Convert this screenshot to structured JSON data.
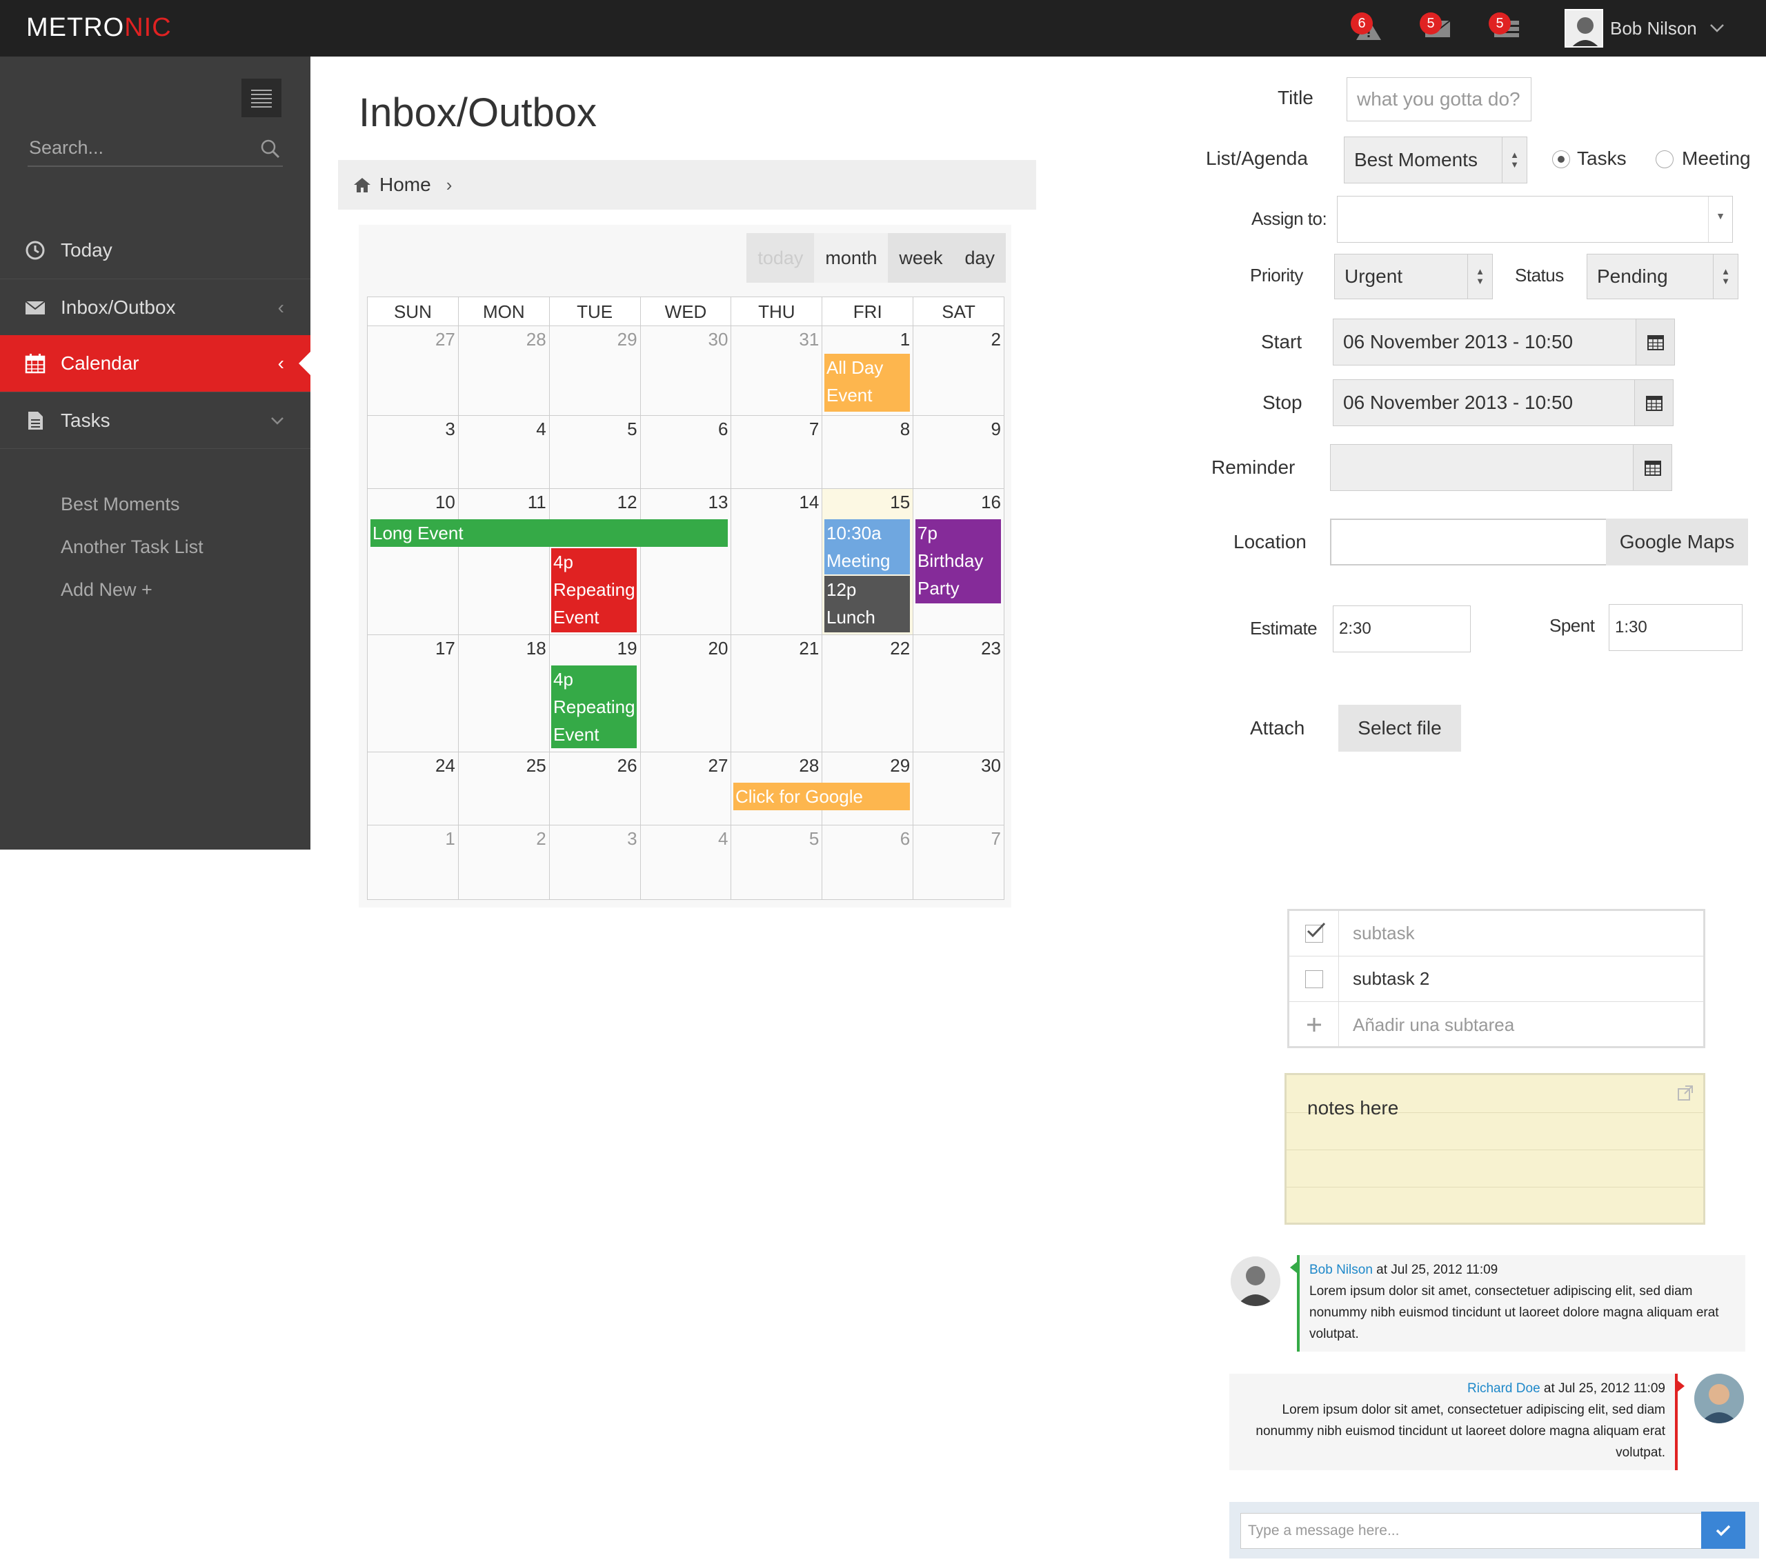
{
  "brand": {
    "name_main": "METRO",
    "name_accent": "NIC",
    "accent_color": "#e02222"
  },
  "header": {
    "notifications": {
      "count": "6",
      "icon": "warning-icon"
    },
    "inbox": {
      "count": "5",
      "icon": "envelope-icon"
    },
    "tasks": {
      "count": "5",
      "icon": "tasks-icon"
    },
    "user_name": "Bob Nilson"
  },
  "sidebar": {
    "search_placeholder": "Search...",
    "items": [
      {
        "label": "Today",
        "icon": "clock-icon"
      },
      {
        "label": "Inbox/Outbox",
        "icon": "envelope-icon"
      },
      {
        "label": "Calendar",
        "icon": "calendar-icon",
        "active": true
      },
      {
        "label": "Tasks",
        "icon": "file-icon"
      }
    ],
    "sub_items": [
      "Best Moments",
      "Another Task List",
      "Add New +"
    ]
  },
  "page": {
    "title": "Inbox/Outbox",
    "breadcrumb": "Home"
  },
  "calendar": {
    "buttons": [
      "today",
      "month",
      "week",
      "day"
    ],
    "day_headers": [
      "SUN",
      "MON",
      "TUE",
      "WED",
      "THU",
      "FRI",
      "SAT"
    ],
    "weeks": [
      [
        "27",
        "28",
        "29",
        "30",
        "31",
        "1",
        "2"
      ],
      [
        "3",
        "4",
        "5",
        "6",
        "7",
        "8",
        "9"
      ],
      [
        "10",
        "11",
        "12",
        "13",
        "14",
        "15",
        "16"
      ],
      [
        "17",
        "18",
        "19",
        "20",
        "21",
        "22",
        "23"
      ],
      [
        "24",
        "25",
        "26",
        "27",
        "28",
        "29",
        "30"
      ],
      [
        "1",
        "2",
        "3",
        "4",
        "5",
        "6",
        "7"
      ]
    ],
    "events": {
      "all_day": "All Day Event",
      "long_event": "Long Event",
      "repeating_1": "4p Repeating Event",
      "meeting": "10:30a Meeting",
      "lunch": "12p Lunch",
      "birthday": "7p Birthday Party",
      "repeating_2": "4p Repeating Event",
      "google": "Click for Google"
    },
    "colors": {
      "orange": "#fdb64e",
      "green": "#35aa47",
      "red": "#e02222",
      "blue": "#6fa7e0",
      "dark": "#555555",
      "purple": "#852b99"
    }
  },
  "form": {
    "title_label": "Title",
    "title_placeholder": "what you gotta do?",
    "list_label": "List/Agenda",
    "list_value": "Best Moments",
    "radio_tasks": "Tasks",
    "radio_meeting": "Meeting",
    "assign_label": "Assign to:",
    "priority_label": "Priority",
    "priority_value": "Urgent",
    "status_label": "Status",
    "status_value": "Pending",
    "start_label": "Start",
    "start_value": "06 November 2013 - 10:50",
    "stop_label": "Stop",
    "stop_value": "06 November 2013 - 10:50",
    "reminder_label": "Reminder",
    "location_label": "Location",
    "maps_button": "Google Maps",
    "estimate_label": "Estimate",
    "estimate_value": "2:30",
    "spent_label": "Spent",
    "spent_value": "1:30",
    "attach_label": "Attach",
    "select_file_button": "Select file"
  },
  "subtasks": [
    {
      "text": "subtask",
      "checked": true
    },
    {
      "text": "subtask 2",
      "checked": false
    },
    {
      "text": "Añadir una subtarea",
      "add": true
    }
  ],
  "notes": {
    "text": "notes here"
  },
  "chat": {
    "messages": [
      {
        "author": "Bob Nilson",
        "time": "at Jul 25, 2012 11:09",
        "body": "Lorem ipsum dolor sit amet, consectetuer adipiscing elit, sed diam nonummy nibh euismod tincidunt ut laoreet dolore magna aliquam erat volutpat."
      },
      {
        "author": "Richard Doe",
        "time": "at Jul 25, 2012 11:09",
        "body": "Lorem ipsum dolor sit amet, consectetuer adipiscing elit, sed diam nonummy nibh euismod tincidunt ut laoreet dolore magna aliquam erat volutpat."
      }
    ],
    "input_placeholder": "Type a message here..."
  }
}
